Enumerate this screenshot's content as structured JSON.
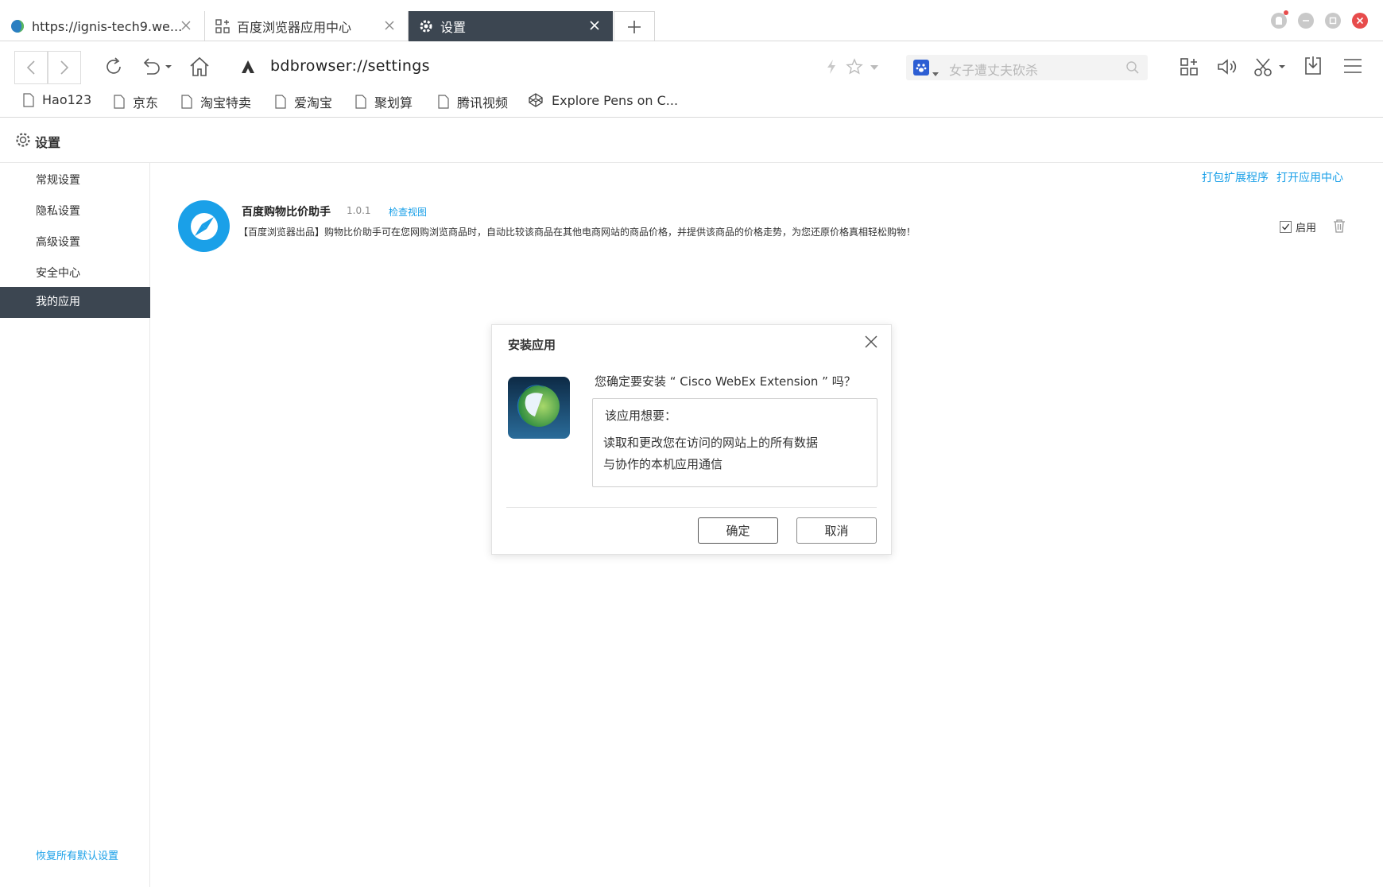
{
  "tabs": [
    {
      "label": "https://ignis-tech9.we...",
      "icon": "webex-favicon-icon"
    },
    {
      "label": "百度浏览器应用中心",
      "icon": "app-grid-icon"
    },
    {
      "label": "设置",
      "icon": "gear-icon",
      "active": true
    }
  ],
  "toolbar": {
    "address": "bdbrowser://settings",
    "search_placeholder": "女子遭丈夫砍杀"
  },
  "bookmarks": [
    {
      "label": "Hao123"
    },
    {
      "label": "京东"
    },
    {
      "label": "淘宝特卖"
    },
    {
      "label": "爱淘宝"
    },
    {
      "label": "聚划算"
    },
    {
      "label": "腾讯视频"
    },
    {
      "label": "Explore Pens on C..."
    }
  ],
  "settings": {
    "title": "设置",
    "nav": [
      {
        "label": "常规设置"
      },
      {
        "label": "隐私设置"
      },
      {
        "label": "高级设置"
      },
      {
        "label": "安全中心"
      },
      {
        "label": "我的应用",
        "active": true
      }
    ],
    "restore_defaults": "恢复所有默认设置",
    "links": {
      "pack": "打包扩展程序",
      "open_center": "打开应用中心"
    },
    "extension": {
      "name": "百度购物比价助手",
      "version": "1.0.1",
      "inspect": "检查视图",
      "description": "【百度浏览器出品】购物比价助手可在您网购浏览商品时，自动比较该商品在其他电商网站的商品价格，并提供该商品的价格走势，为您还原价格真相轻松购物！",
      "enable_label": "启用",
      "enabled": true
    }
  },
  "dialog": {
    "title": "安装应用",
    "question": "您确定要安装 “ Cisco WebEx Extension ” 吗？",
    "perm_header": "该应用想要：",
    "permissions": [
      "读取和更改您在访问的网站上的所有数据",
      "与协作的本机应用通信"
    ],
    "confirm": "确定",
    "cancel": "取消"
  },
  "colors": {
    "accent": "#1aa0e8",
    "active_bg": "#3c4651",
    "close_red": "#e74c4c"
  }
}
